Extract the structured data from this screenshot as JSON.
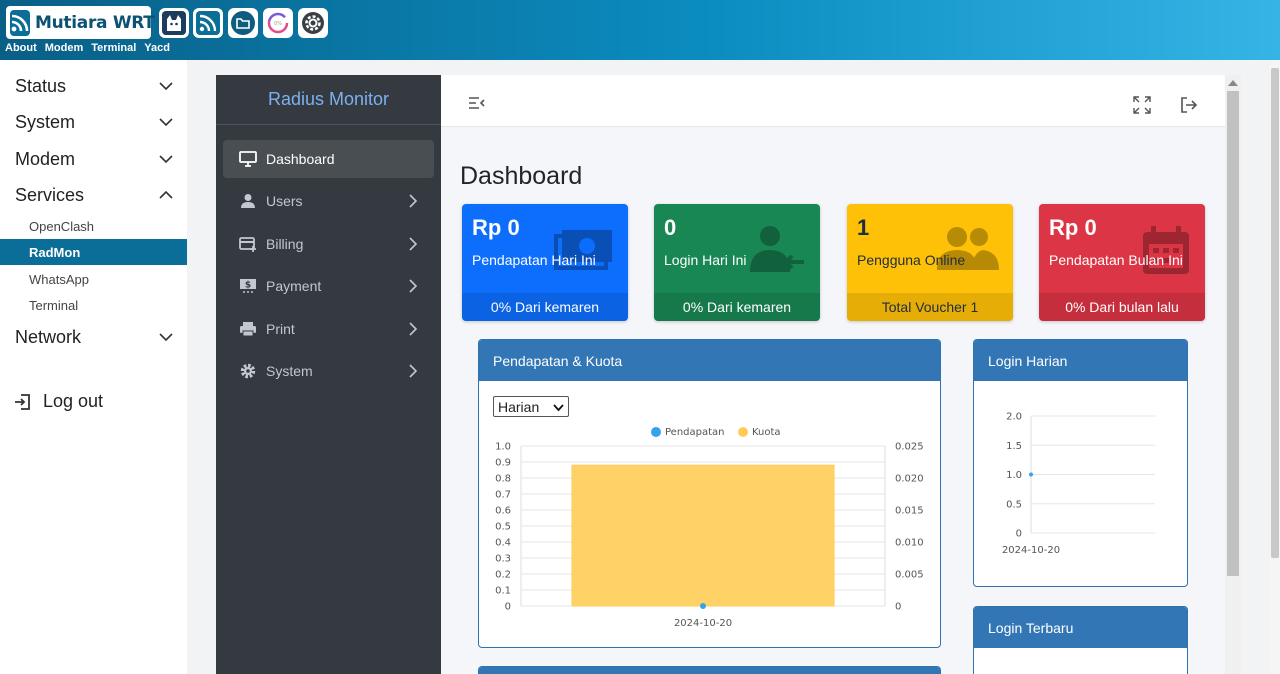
{
  "header": {
    "brand": "Mutiara WRT",
    "nav": [
      "About",
      "Modem",
      "Terminal",
      "Yacd"
    ],
    "icons": [
      "clash-cat-icon",
      "rss-feed-icon",
      "folder-icon",
      "speed-gauge-icon",
      "settings-gear-icon"
    ]
  },
  "sitenav": {
    "items": [
      {
        "label": "Status",
        "expanded": false
      },
      {
        "label": "System",
        "expanded": false
      },
      {
        "label": "Modem",
        "expanded": false
      },
      {
        "label": "Services",
        "expanded": true
      },
      {
        "label": "Network",
        "expanded": false
      }
    ],
    "services_sub": [
      "OpenClash",
      "RadMon",
      "WhatsApp",
      "Terminal"
    ],
    "active_sub": "RadMon",
    "logout": "Log out"
  },
  "app": {
    "title": "Radius Monitor",
    "menu": [
      {
        "label": "Dashboard",
        "icon": "monitor-icon",
        "active": true
      },
      {
        "label": "Users",
        "icon": "user-icon"
      },
      {
        "label": "Billing",
        "icon": "billing-card-icon"
      },
      {
        "label": "Payment",
        "icon": "payment-money-icon"
      },
      {
        "label": "Print",
        "icon": "printer-icon"
      },
      {
        "label": "System",
        "icon": "cog-icon"
      }
    ],
    "page_title": "Dashboard"
  },
  "stats": [
    {
      "value": "Rp 0",
      "label": "Pendapatan Hari Ini",
      "footer": "0% Dari kemaren",
      "color": "#0d6efd"
    },
    {
      "value": "0",
      "label": "Login Hari Ini",
      "footer": "0% Dari kemaren",
      "color": "#198754"
    },
    {
      "value": "1",
      "label": "Pengguna Online",
      "footer": "Total Voucher 1",
      "color": "#ffc107"
    },
    {
      "value": "Rp 0",
      "label": "Pendapatan Bulan Ini",
      "footer": "0% Dari bulan lalu",
      "color": "#dc3545"
    }
  ],
  "cards": {
    "revenue": {
      "title": "Pendapatan & Kuota",
      "select_value": "Harian"
    },
    "login_daily": {
      "title": "Login Harian"
    },
    "login_latest": {
      "title": "Login Terbaru"
    }
  },
  "chart_data": [
    {
      "type": "bar",
      "categories": [
        "2024-10-20"
      ],
      "series": [
        {
          "name": "Pendapatan",
          "type": "line",
          "axis": "left",
          "values": [
            0
          ],
          "color": "#36a2eb"
        },
        {
          "name": "Kuota",
          "type": "bar",
          "axis": "right",
          "values": [
            0.022
          ],
          "color": "#ffcd56"
        }
      ],
      "ylim_left": [
        0,
        1.0
      ],
      "yticks_left": [
        "0",
        "0.1",
        "0.2",
        "0.3",
        "0.4",
        "0.5",
        "0.6",
        "0.7",
        "0.8",
        "0.9",
        "1.0"
      ],
      "ylim_right": [
        0,
        0.025
      ],
      "yticks_right": [
        "0",
        "0.005",
        "0.010",
        "0.015",
        "0.020",
        "0.025"
      ],
      "legend": "top",
      "grid": true
    },
    {
      "type": "line",
      "categories": [
        "2024-10-20"
      ],
      "series": [
        {
          "name": "Login",
          "values": [
            1.0
          ],
          "color": "#36a2eb"
        }
      ],
      "ylim": [
        0,
        2.0
      ],
      "yticks": [
        "0",
        "0.5",
        "1.0",
        "1.5",
        "2.0"
      ],
      "grid": true
    }
  ]
}
